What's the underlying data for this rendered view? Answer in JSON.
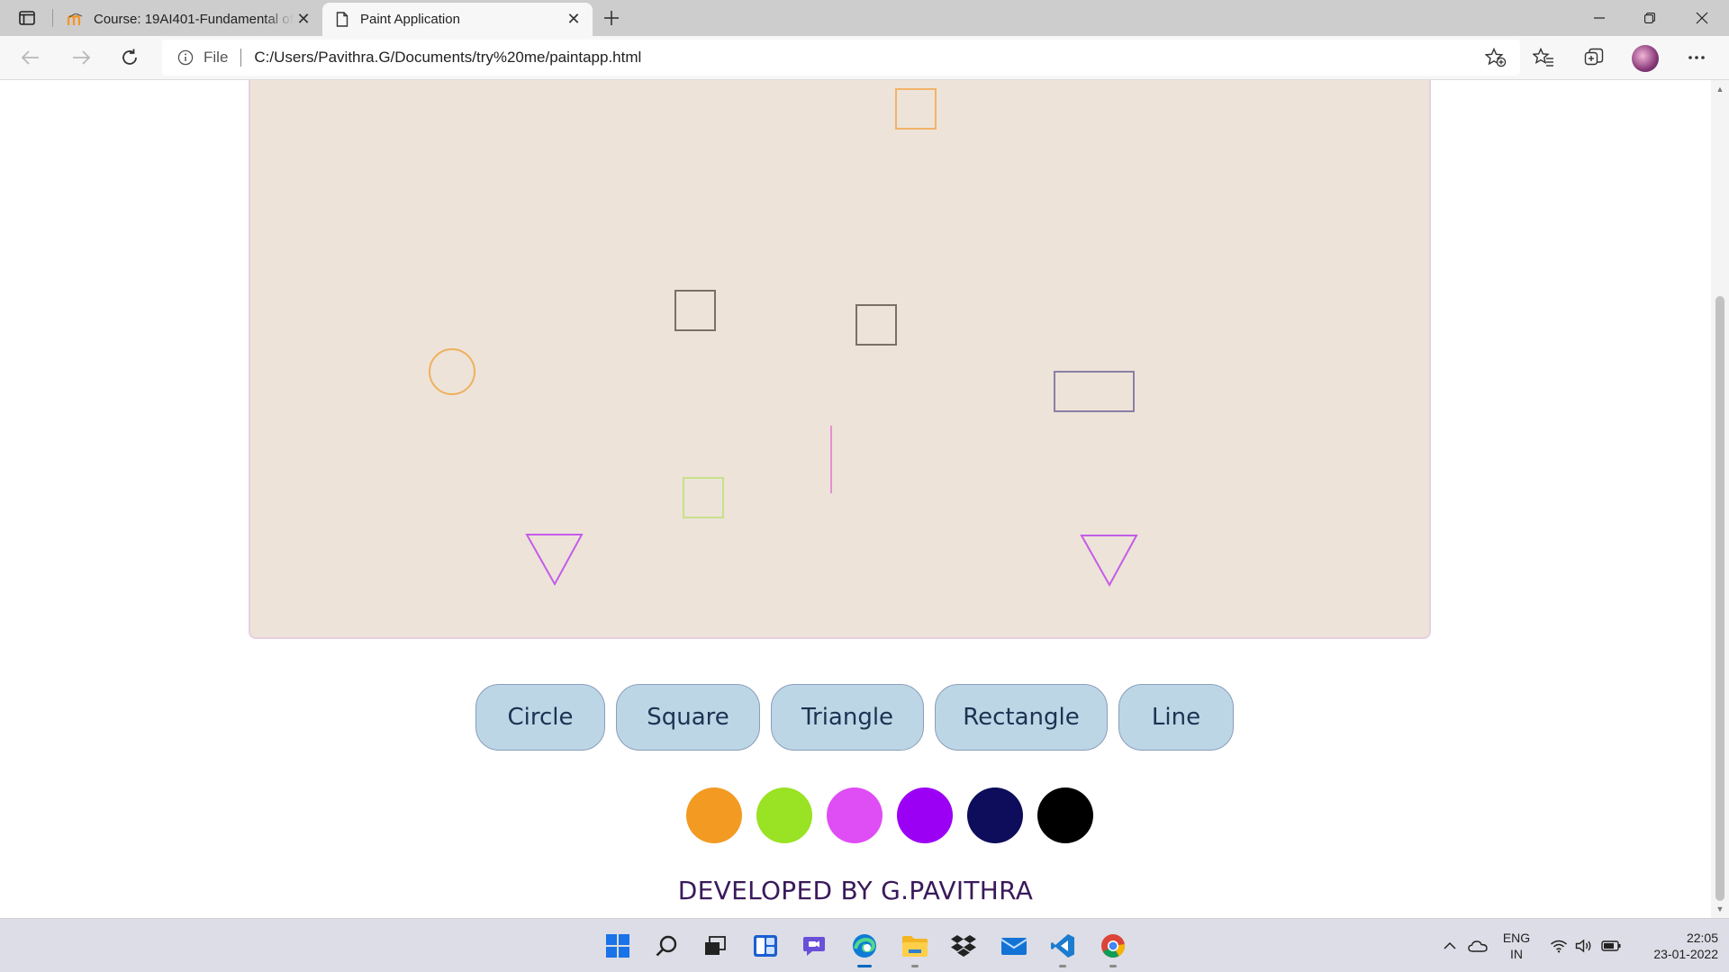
{
  "browser": {
    "tabs": [
      {
        "title": "Course: 19AI401-Fundamental of",
        "active": false,
        "icon": "moodle-icon"
      },
      {
        "title": "Paint Application",
        "active": true,
        "icon": "page-icon"
      }
    ],
    "address": {
      "scheme_label": "File",
      "url": "C:/Users/Pavithra.G/Documents/try%20me/paintapp.html"
    }
  },
  "page": {
    "canvas": {
      "background": "#ede3d9",
      "border_color": "#e7cfe2",
      "drawn_shapes": [
        {
          "type": "square",
          "stroke": "#f2b36a"
        },
        {
          "type": "square",
          "stroke": "#7a7067"
        },
        {
          "type": "square",
          "stroke": "#7a7067"
        },
        {
          "type": "circle",
          "stroke": "#f0b05c"
        },
        {
          "type": "rectangle",
          "stroke": "#8a7fa6"
        },
        {
          "type": "line",
          "stroke": "#e48fd2"
        },
        {
          "type": "square",
          "stroke": "#c7e08a"
        },
        {
          "type": "triangle",
          "stroke": "#c45ce8"
        },
        {
          "type": "triangle",
          "stroke": "#c45ce8"
        }
      ]
    },
    "shape_buttons": [
      {
        "label": "Circle"
      },
      {
        "label": "Square"
      },
      {
        "label": "Triangle"
      },
      {
        "label": "Rectangle"
      },
      {
        "label": "Line"
      }
    ],
    "colors": [
      {
        "name": "orange",
        "hex": "#f29a22"
      },
      {
        "name": "green",
        "hex": "#9ae224"
      },
      {
        "name": "pink",
        "hex": "#df4df5"
      },
      {
        "name": "purple",
        "hex": "#9b00f5"
      },
      {
        "name": "navy",
        "hex": "#0d0d5c"
      },
      {
        "name": "black",
        "hex": "#000000"
      }
    ],
    "footer": "DEVELOPED BY G.PAVITHRA"
  },
  "taskbar": {
    "apps": [
      "start-icon",
      "search-icon",
      "task-view-icon",
      "widgets-icon",
      "chat-icon",
      "edge-icon",
      "file-explorer-icon",
      "dropbox-icon",
      "mail-icon",
      "vscode-icon",
      "chrome-icon"
    ],
    "language": {
      "line1": "ENG",
      "line2": "IN"
    },
    "time": "22:05",
    "date": "23-01-2022"
  }
}
